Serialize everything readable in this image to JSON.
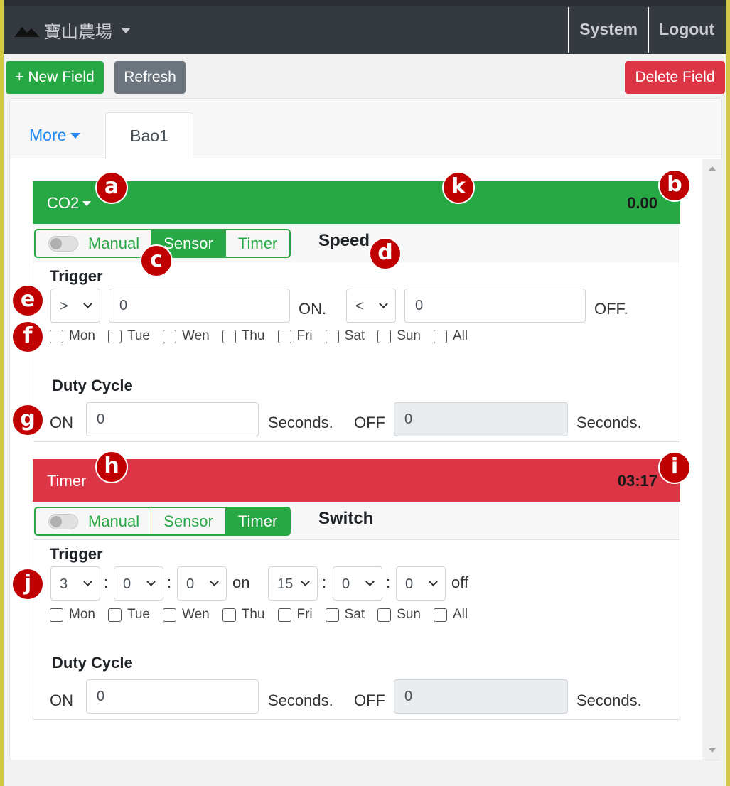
{
  "navbar": {
    "brand": "寶山農場",
    "system": "System",
    "logout": "Logout"
  },
  "actions": {
    "new_field": "+ New Field",
    "refresh": "Refresh",
    "delete_field": "Delete Field"
  },
  "tabs": {
    "more": "More",
    "active": "Bao1"
  },
  "panels": [
    {
      "title": "CO2",
      "value": "0.00",
      "header_color": "#28a745",
      "modes": [
        "Manual",
        "Sensor",
        "Timer"
      ],
      "active_mode": "Sensor",
      "mode_label": "Speed",
      "trigger_title": "Trigger",
      "on_op": ">",
      "on_value": "0",
      "on_label": "ON.",
      "off_op": "<",
      "off_value": "0",
      "off_label": "OFF."
    },
    {
      "title": "Timer",
      "value": "03:17",
      "header_color": "#dc3545",
      "modes": [
        "Manual",
        "Sensor",
        "Timer"
      ],
      "active_mode": "Timer",
      "mode_label": "Switch",
      "trigger_title": "Trigger",
      "on_time": [
        "3",
        "0",
        "0"
      ],
      "on_label": "on",
      "off_time": [
        "15",
        "0",
        "0"
      ],
      "off_label": "off",
      "colon": ":"
    }
  ],
  "days": [
    "Mon",
    "Tue",
    "Wen",
    "Thu",
    "Fri",
    "Sat",
    "Sun",
    "All"
  ],
  "duty": {
    "title": "Duty Cycle",
    "on_label": "ON",
    "on_value": "0",
    "seconds": "Seconds.",
    "off_label": "OFF",
    "off_value": "0"
  },
  "markers": [
    "a",
    "b",
    "c",
    "d",
    "e",
    "f",
    "g",
    "h",
    "i",
    "j",
    "k"
  ]
}
